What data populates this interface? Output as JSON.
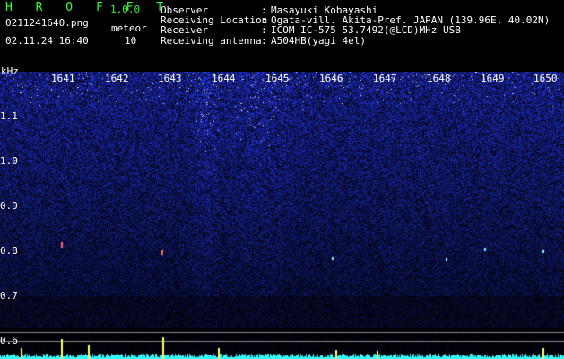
{
  "header": {
    "title": "H R O F F T",
    "version": "1.0.0",
    "filename": "0211241640.png",
    "meteor_label": "meteor",
    "datetime": "02.11.24 16:40",
    "meteor_count": "10",
    "fields": [
      {
        "label": "Observer",
        "value": "Masayuki Kobayashi"
      },
      {
        "label": "Receiving Location",
        "value": "Ogata-vill. Akita-Pref. JAPAN (139.96E, 40.02N)"
      },
      {
        "label": "Receiver",
        "value": "ICOM IC-575 53.7492(@LCD)MHz USB"
      },
      {
        "label": "Receiving antenna",
        "value": "A504HB(yagi 4el)"
      }
    ],
    "colon": ":"
  },
  "spectrogram": {
    "unit_label": "kHz",
    "time_ticks": [
      "1641",
      "1642",
      "1643",
      "1644",
      "1645",
      "1646",
      "1647",
      "1648",
      "1649",
      "1650"
    ],
    "freq_ticks": [
      "1.1",
      "1.0",
      "0.9",
      "0.8",
      "0.7",
      "0.6"
    ]
  },
  "colors": {
    "background": "#000000",
    "header_green": "#33ff33",
    "noise_blue": "#1a2aa8",
    "meteor": "#ffff66",
    "baseline": "#33ffff"
  }
}
